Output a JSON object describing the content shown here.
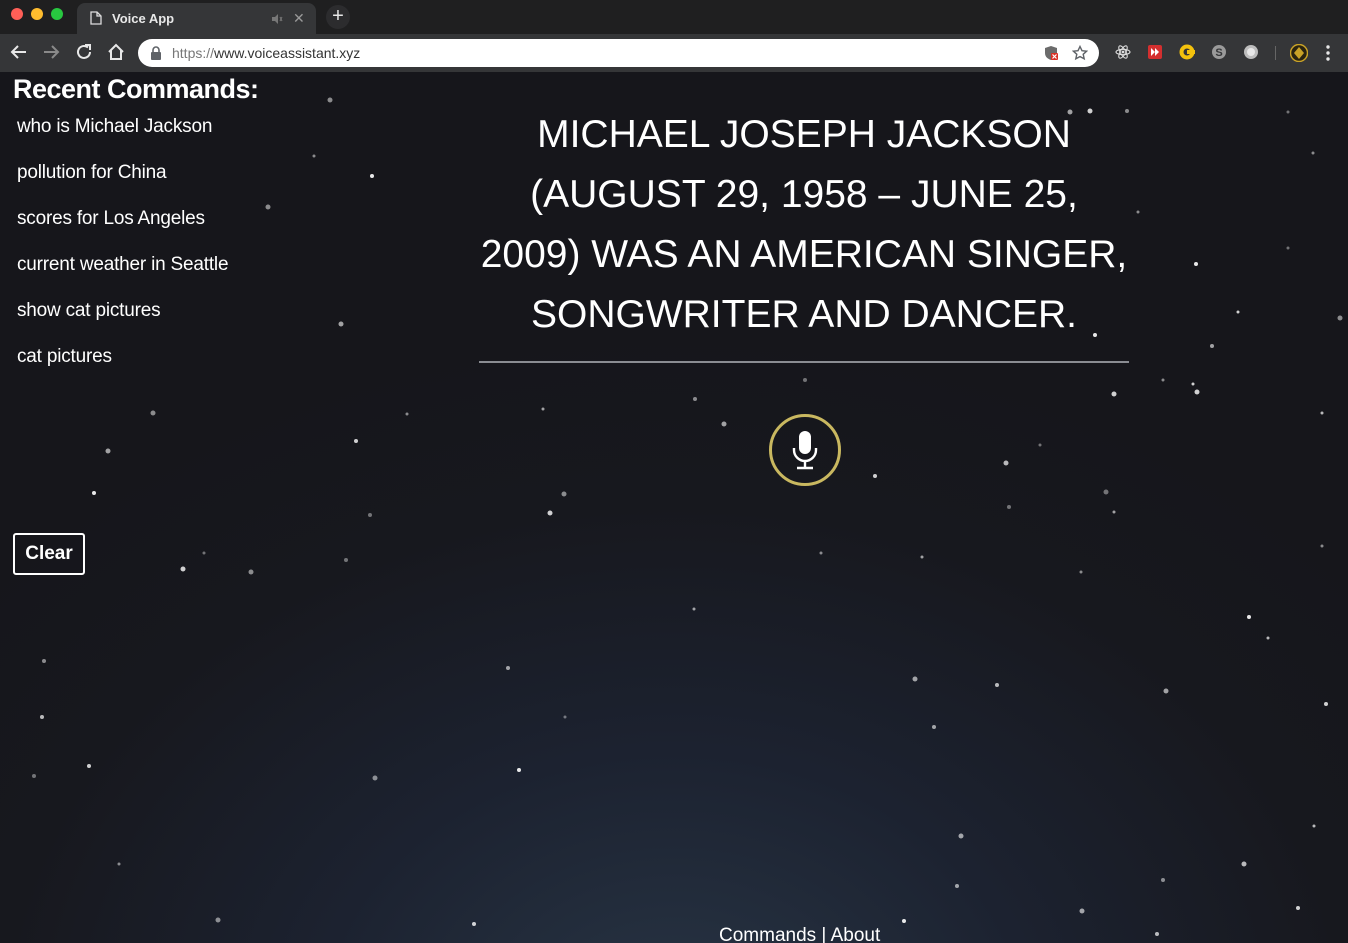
{
  "browser": {
    "tab_title": "Voice App",
    "url_scheme": "https://",
    "url_host": "www.voiceassistant.xyz"
  },
  "sidebar": {
    "title": "Recent Commands:",
    "commands": [
      "who is Michael Jackson",
      "pollution for China",
      "scores for Los Angeles",
      "current weather in Seattle",
      "show cat pictures",
      "cat pictures"
    ],
    "clear_label": "Clear"
  },
  "main": {
    "answer_text": "MICHAEL JOSEPH JACKSON (AUGUST 29, 1958 – JUNE 25, 2009) WAS AN AMERICAN SINGER, SONGWRITER AND DANCER."
  },
  "footer": {
    "commands_label": "Commands",
    "separator": " | ",
    "about_label": "About"
  },
  "colors": {
    "mic_ring": "#c9b860",
    "page_background": "#17181e"
  }
}
